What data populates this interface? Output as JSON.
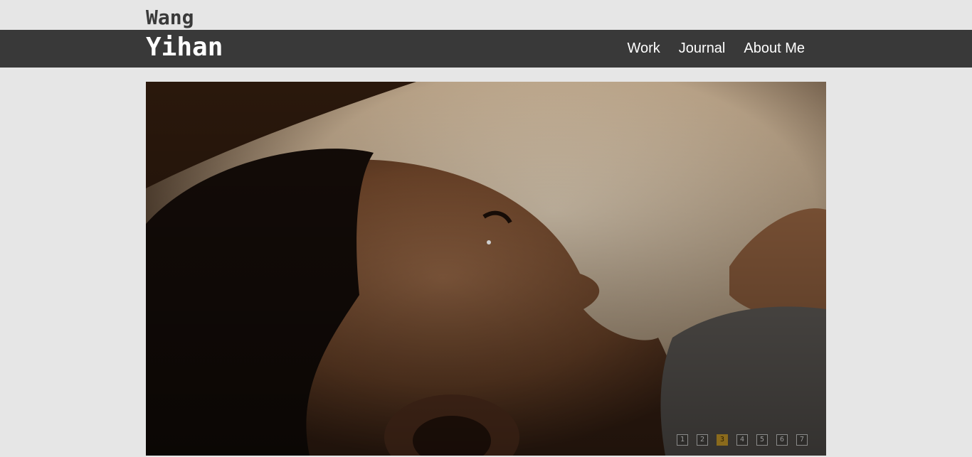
{
  "site": {
    "first_name": "Wang",
    "last_name": "Yihan"
  },
  "nav": {
    "items": [
      {
        "label": "Work"
      },
      {
        "label": "Journal"
      },
      {
        "label": "About Me"
      }
    ]
  },
  "slideshow": {
    "image_icon": "photo-child-crying",
    "pager": [
      "1",
      "2",
      "3",
      "4",
      "5",
      "6",
      "7"
    ],
    "active_index": 2,
    "colors": {
      "active": "#8a6a1c",
      "inactive_border": "#8a8a8a"
    }
  }
}
